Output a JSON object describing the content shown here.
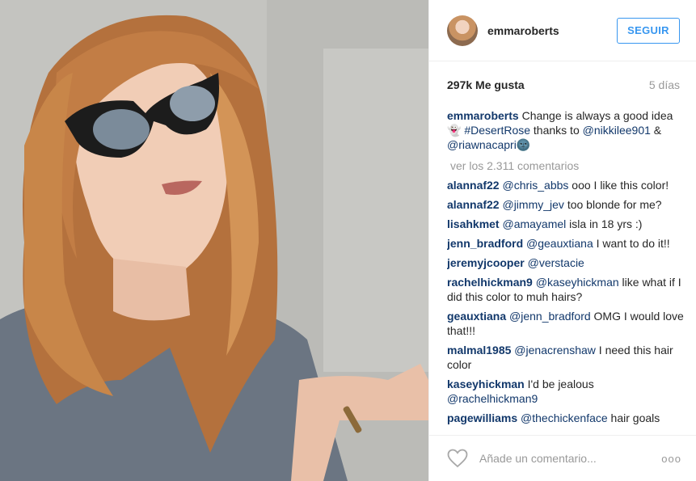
{
  "header": {
    "username": "emmaroberts",
    "follow_label": "SEGUIR"
  },
  "stats": {
    "likes": "297k Me gusta",
    "time": "5 días"
  },
  "caption": {
    "user": "emmaroberts",
    "text1": " Change is always a good idea ",
    "emoji1": "👻",
    "tag": "#DesertRose",
    "text2": " thanks to ",
    "mention1": "@nikkilee901",
    "text3": " & ",
    "mention2": "@riawnacapri",
    "emoji2": "🌚"
  },
  "view_all": "ver los 2.311 comentarios",
  "comments": [
    {
      "user": "alannaf22",
      "mention": "@chris_abbs",
      "text": " ooo I like this color!"
    },
    {
      "user": "alannaf22",
      "mention": "@jimmy_jev",
      "text": " too blonde for me?"
    },
    {
      "user": "lisahkmet",
      "mention": "@amayamel",
      "text": " isla in 18 yrs :)"
    },
    {
      "user": "jenn_bradford",
      "mention": "@geauxtiana",
      "text": " I want to do it!!"
    },
    {
      "user": "jeremyjcooper",
      "mention": "@verstacie",
      "text": ""
    },
    {
      "user": "rachelhickman9",
      "mention": "@kaseyhickman",
      "text": " like what if I did this color to muh hairs?"
    },
    {
      "user": "geauxtiana",
      "mention": "@jenn_bradford",
      "text": " OMG I would love that!!!"
    },
    {
      "user": "malmal1985",
      "mention": "@jenacrenshaw",
      "text": " I need this hair color"
    },
    {
      "user": "kaseyhickman",
      "mention": "",
      "text": " I'd be jealous ",
      "mention_after": "@rachelhickman9"
    },
    {
      "user": "pagewilliams",
      "mention": "@thechickenface",
      "text": " hair goals"
    }
  ],
  "footer": {
    "add_placeholder": "Añade un comentario...",
    "more_icon": "ooo"
  },
  "icons": {
    "heart": "heart-icon",
    "options": "more-options-icon"
  }
}
